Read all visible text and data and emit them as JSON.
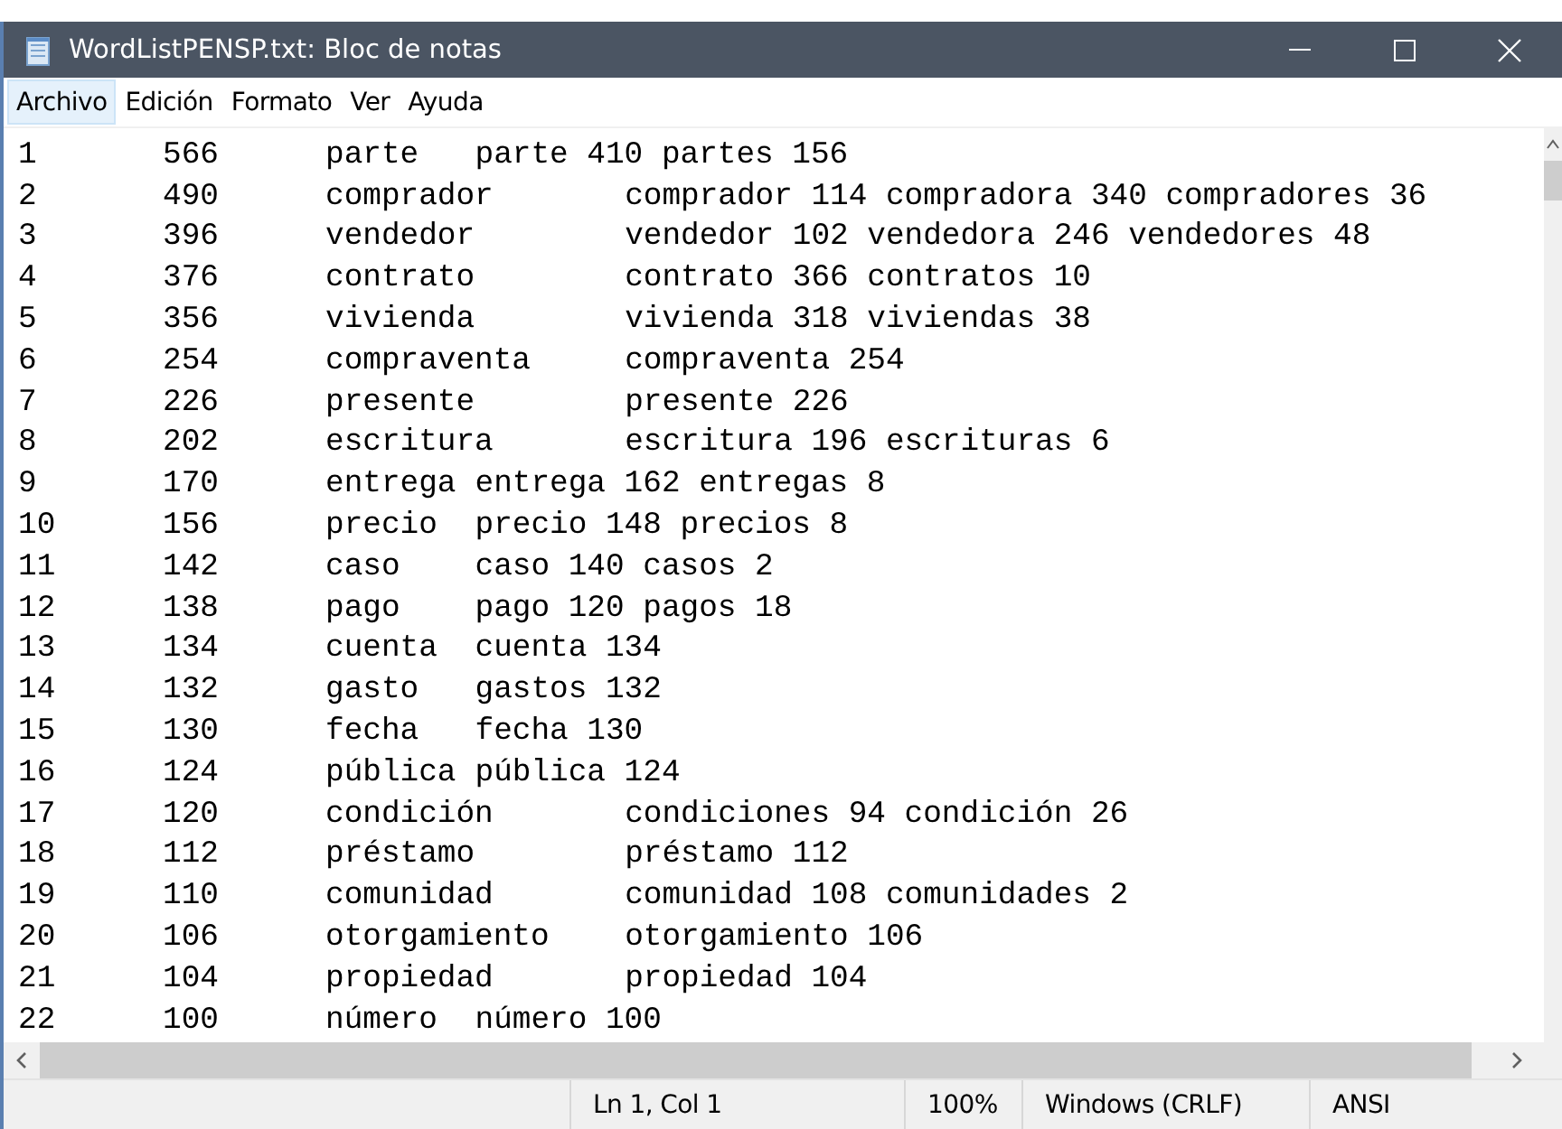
{
  "window": {
    "title": "WordListPENSP.txt: Bloc de notas"
  },
  "menu": [
    {
      "label": "Archivo",
      "selected": true
    },
    {
      "label": "Edición",
      "selected": false
    },
    {
      "label": "Formato",
      "selected": false
    },
    {
      "label": "Ver",
      "selected": false
    },
    {
      "label": "Ayuda",
      "selected": false
    }
  ],
  "lines": [
    {
      "number": "1",
      "frequency": "566",
      "lemma": "parte",
      "forms": "parte 410 partes 156"
    },
    {
      "number": "2",
      "frequency": "490",
      "lemma": "comprador",
      "forms": "comprador 114 compradora 340 compradores 36"
    },
    {
      "number": "3",
      "frequency": "396",
      "lemma": "vendedor",
      "forms": "vendedor 102 vendedora 246 vendedores 48"
    },
    {
      "number": "4",
      "frequency": "376",
      "lemma": "contrato",
      "forms": "contrato 366 contratos 10"
    },
    {
      "number": "5",
      "frequency": "356",
      "lemma": "vivienda",
      "forms": "vivienda 318 viviendas 38"
    },
    {
      "number": "6",
      "frequency": "254",
      "lemma": "compraventa",
      "forms": "compraventa 254"
    },
    {
      "number": "7",
      "frequency": "226",
      "lemma": "presente",
      "forms": "presente 226"
    },
    {
      "number": "8",
      "frequency": "202",
      "lemma": "escritura",
      "forms": "escritura 196 escrituras 6"
    },
    {
      "number": "9",
      "frequency": "170",
      "lemma": "entrega",
      "forms": "entrega 162 entregas 8"
    },
    {
      "number": "10",
      "frequency": "156",
      "lemma": "precio",
      "forms": "precio 148 precios 8"
    },
    {
      "number": "11",
      "frequency": "142",
      "lemma": "caso",
      "forms": "caso 140 casos 2"
    },
    {
      "number": "12",
      "frequency": "138",
      "lemma": "pago",
      "forms": "pago 120 pagos 18"
    },
    {
      "number": "13",
      "frequency": "134",
      "lemma": "cuenta",
      "forms": "cuenta 134"
    },
    {
      "number": "14",
      "frequency": "132",
      "lemma": "gasto",
      "forms": "gastos 132"
    },
    {
      "number": "15",
      "frequency": "130",
      "lemma": "fecha",
      "forms": "fecha 130"
    },
    {
      "number": "16",
      "frequency": "124",
      "lemma": "pública",
      "forms": "pública 124"
    },
    {
      "number": "17",
      "frequency": "120",
      "lemma": "condición",
      "forms": "condiciones 94 condición 26"
    },
    {
      "number": "18",
      "frequency": "112",
      "lemma": "préstamo",
      "forms": "préstamo 112"
    },
    {
      "number": "19",
      "frequency": "110",
      "lemma": "comunidad",
      "forms": "comunidad 108 comunidades 2"
    },
    {
      "number": "20",
      "frequency": "106",
      "lemma": "otorgamiento",
      "forms": "otorgamiento 106"
    },
    {
      "number": "21",
      "frequency": "104",
      "lemma": "propiedad",
      "forms": "propiedad 104"
    },
    {
      "number": "22",
      "frequency": "100",
      "lemma": "número",
      "forms": "número 100"
    }
  ],
  "status_bar": {
    "position": "Ln 1, Col 1",
    "zoom": "100%",
    "line_ending": "Windows (CRLF)",
    "encoding": "ANSI"
  }
}
